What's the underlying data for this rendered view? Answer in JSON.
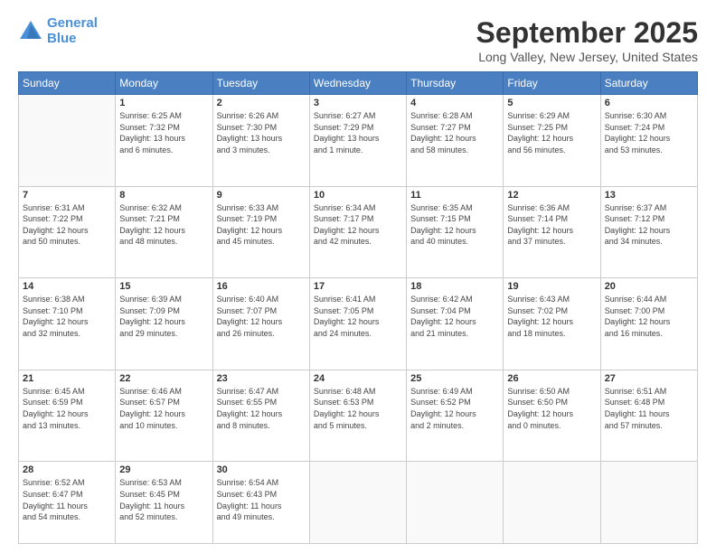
{
  "logo": {
    "line1": "General",
    "line2": "Blue"
  },
  "header": {
    "month": "September 2025",
    "location": "Long Valley, New Jersey, United States"
  },
  "weekdays": [
    "Sunday",
    "Monday",
    "Tuesday",
    "Wednesday",
    "Thursday",
    "Friday",
    "Saturday"
  ],
  "weeks": [
    [
      {
        "day": "",
        "info": ""
      },
      {
        "day": "1",
        "info": "Sunrise: 6:25 AM\nSunset: 7:32 PM\nDaylight: 13 hours\nand 6 minutes."
      },
      {
        "day": "2",
        "info": "Sunrise: 6:26 AM\nSunset: 7:30 PM\nDaylight: 13 hours\nand 3 minutes."
      },
      {
        "day": "3",
        "info": "Sunrise: 6:27 AM\nSunset: 7:29 PM\nDaylight: 13 hours\nand 1 minute."
      },
      {
        "day": "4",
        "info": "Sunrise: 6:28 AM\nSunset: 7:27 PM\nDaylight: 12 hours\nand 58 minutes."
      },
      {
        "day": "5",
        "info": "Sunrise: 6:29 AM\nSunset: 7:25 PM\nDaylight: 12 hours\nand 56 minutes."
      },
      {
        "day": "6",
        "info": "Sunrise: 6:30 AM\nSunset: 7:24 PM\nDaylight: 12 hours\nand 53 minutes."
      }
    ],
    [
      {
        "day": "7",
        "info": "Sunrise: 6:31 AM\nSunset: 7:22 PM\nDaylight: 12 hours\nand 50 minutes."
      },
      {
        "day": "8",
        "info": "Sunrise: 6:32 AM\nSunset: 7:21 PM\nDaylight: 12 hours\nand 48 minutes."
      },
      {
        "day": "9",
        "info": "Sunrise: 6:33 AM\nSunset: 7:19 PM\nDaylight: 12 hours\nand 45 minutes."
      },
      {
        "day": "10",
        "info": "Sunrise: 6:34 AM\nSunset: 7:17 PM\nDaylight: 12 hours\nand 42 minutes."
      },
      {
        "day": "11",
        "info": "Sunrise: 6:35 AM\nSunset: 7:15 PM\nDaylight: 12 hours\nand 40 minutes."
      },
      {
        "day": "12",
        "info": "Sunrise: 6:36 AM\nSunset: 7:14 PM\nDaylight: 12 hours\nand 37 minutes."
      },
      {
        "day": "13",
        "info": "Sunrise: 6:37 AM\nSunset: 7:12 PM\nDaylight: 12 hours\nand 34 minutes."
      }
    ],
    [
      {
        "day": "14",
        "info": "Sunrise: 6:38 AM\nSunset: 7:10 PM\nDaylight: 12 hours\nand 32 minutes."
      },
      {
        "day": "15",
        "info": "Sunrise: 6:39 AM\nSunset: 7:09 PM\nDaylight: 12 hours\nand 29 minutes."
      },
      {
        "day": "16",
        "info": "Sunrise: 6:40 AM\nSunset: 7:07 PM\nDaylight: 12 hours\nand 26 minutes."
      },
      {
        "day": "17",
        "info": "Sunrise: 6:41 AM\nSunset: 7:05 PM\nDaylight: 12 hours\nand 24 minutes."
      },
      {
        "day": "18",
        "info": "Sunrise: 6:42 AM\nSunset: 7:04 PM\nDaylight: 12 hours\nand 21 minutes."
      },
      {
        "day": "19",
        "info": "Sunrise: 6:43 AM\nSunset: 7:02 PM\nDaylight: 12 hours\nand 18 minutes."
      },
      {
        "day": "20",
        "info": "Sunrise: 6:44 AM\nSunset: 7:00 PM\nDaylight: 12 hours\nand 16 minutes."
      }
    ],
    [
      {
        "day": "21",
        "info": "Sunrise: 6:45 AM\nSunset: 6:59 PM\nDaylight: 12 hours\nand 13 minutes."
      },
      {
        "day": "22",
        "info": "Sunrise: 6:46 AM\nSunset: 6:57 PM\nDaylight: 12 hours\nand 10 minutes."
      },
      {
        "day": "23",
        "info": "Sunrise: 6:47 AM\nSunset: 6:55 PM\nDaylight: 12 hours\nand 8 minutes."
      },
      {
        "day": "24",
        "info": "Sunrise: 6:48 AM\nSunset: 6:53 PM\nDaylight: 12 hours\nand 5 minutes."
      },
      {
        "day": "25",
        "info": "Sunrise: 6:49 AM\nSunset: 6:52 PM\nDaylight: 12 hours\nand 2 minutes."
      },
      {
        "day": "26",
        "info": "Sunrise: 6:50 AM\nSunset: 6:50 PM\nDaylight: 12 hours\nand 0 minutes."
      },
      {
        "day": "27",
        "info": "Sunrise: 6:51 AM\nSunset: 6:48 PM\nDaylight: 11 hours\nand 57 minutes."
      }
    ],
    [
      {
        "day": "28",
        "info": "Sunrise: 6:52 AM\nSunset: 6:47 PM\nDaylight: 11 hours\nand 54 minutes."
      },
      {
        "day": "29",
        "info": "Sunrise: 6:53 AM\nSunset: 6:45 PM\nDaylight: 11 hours\nand 52 minutes."
      },
      {
        "day": "30",
        "info": "Sunrise: 6:54 AM\nSunset: 6:43 PM\nDaylight: 11 hours\nand 49 minutes."
      },
      {
        "day": "",
        "info": ""
      },
      {
        "day": "",
        "info": ""
      },
      {
        "day": "",
        "info": ""
      },
      {
        "day": "",
        "info": ""
      }
    ]
  ]
}
